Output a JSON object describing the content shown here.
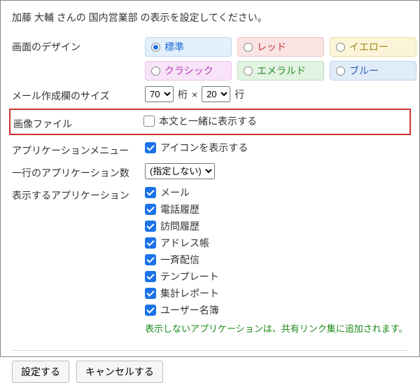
{
  "intro": "加藤 大輔 さんの 国内営業部 の表示を設定してください。",
  "labels": {
    "design": "画面のデザイン",
    "mail_size": "メール作成欄のサイズ",
    "image_file": "画像ファイル",
    "app_menu": "アプリケーションメニュー",
    "apps_per_row": "一行のアプリケーション数",
    "show_apps": "表示するアプリケーション"
  },
  "themes": [
    {
      "key": "standard",
      "label": "標準",
      "selected": true
    },
    {
      "key": "red",
      "label": "レッド",
      "selected": false
    },
    {
      "key": "yellow",
      "label": "イエロー",
      "selected": false
    },
    {
      "key": "classic",
      "label": "クラシック",
      "selected": false
    },
    {
      "key": "emerald",
      "label": "エメラルド",
      "selected": false
    },
    {
      "key": "blue",
      "label": "ブルー",
      "selected": false
    }
  ],
  "mail_size": {
    "cols_value": "70",
    "cols_unit": "桁",
    "times": "×",
    "rows_value": "20",
    "rows_unit": "行"
  },
  "image_file": {
    "checked": false,
    "label": "本文と一緒に表示する"
  },
  "app_menu": {
    "checked": true,
    "label": "アイコンを表示する"
  },
  "apps_per_row": {
    "value": "(指定しない)"
  },
  "apps": [
    {
      "label": "メール",
      "checked": true
    },
    {
      "label": "電話履歴",
      "checked": true
    },
    {
      "label": "訪問履歴",
      "checked": true
    },
    {
      "label": "アドレス帳",
      "checked": true
    },
    {
      "label": "一斉配信",
      "checked": true
    },
    {
      "label": "テンプレート",
      "checked": true
    },
    {
      "label": "集計レポート",
      "checked": true
    },
    {
      "label": "ユーザー名簿",
      "checked": true
    }
  ],
  "note": "表示しないアプリケーションは、共有リンク集に追加されます。",
  "buttons": {
    "submit": "設定する",
    "cancel": "キャンセルする"
  }
}
